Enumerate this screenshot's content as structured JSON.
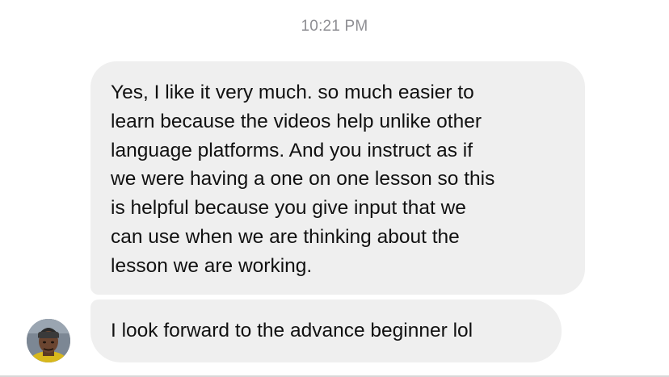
{
  "conversation": {
    "timestamp": "10:21 PM",
    "messages": [
      {
        "sender": "other",
        "lines": [
          "Yes, I like it very much. so much easier to",
          "learn because the videos help unlike other",
          "language platforms. And you instruct as if",
          "we were having a one on one lesson so this",
          "is helpful because you give input that we",
          "can use when we are thinking about the",
          "lesson we are working."
        ]
      },
      {
        "sender": "other",
        "text": "I look forward to the advance beginner lol"
      }
    ],
    "avatar_icon": "user-avatar-photo"
  },
  "colors": {
    "bubble_background": "#efefef",
    "timestamp": "#8e8e93",
    "text": "#111111"
  }
}
